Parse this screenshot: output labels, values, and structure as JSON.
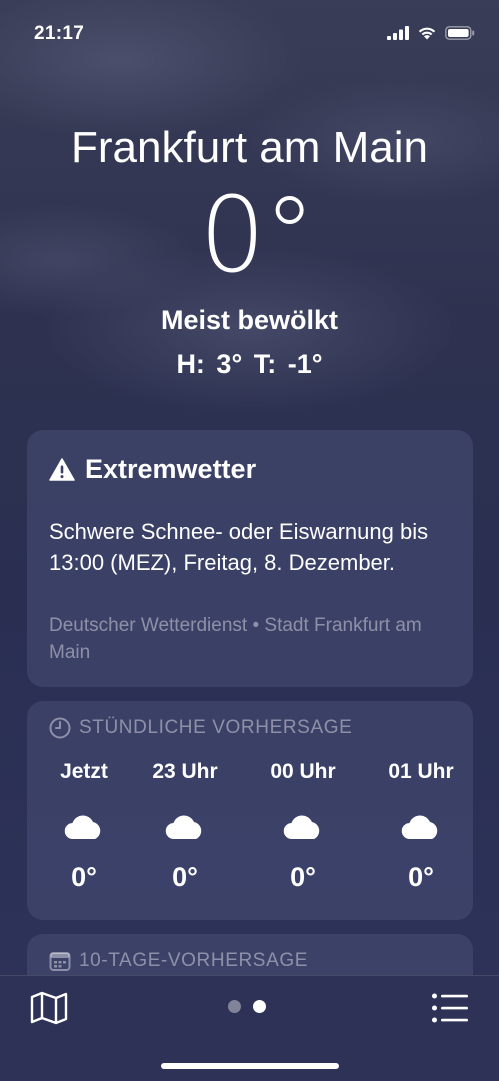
{
  "status": {
    "time": "21:17"
  },
  "location": {
    "city": "Frankfurt am Main"
  },
  "current": {
    "temp": "0°",
    "condition": "Meist bewölkt",
    "hilo": "H: 3°  T: -1°"
  },
  "alert": {
    "title": "Extremwetter",
    "body": "Schwere Schnee- oder Eiswarnung bis 13:00 (MEZ), Freitag, 8. Dezember.",
    "source": "Deutscher Wetterdienst • Stadt Frankfurt am Main"
  },
  "hourly": {
    "header": "STÜNDLICHE VORHERSAGE",
    "items": [
      {
        "label": "Jetzt",
        "icon": "cloud-icon",
        "temp": "0°"
      },
      {
        "label": "23 Uhr",
        "icon": "cloud-icon",
        "temp": "0°"
      },
      {
        "label": "00 Uhr",
        "icon": "cloud-icon",
        "temp": "0°"
      },
      {
        "label": "01 Uhr",
        "icon": "cloud-icon",
        "temp": "0°"
      }
    ]
  },
  "daily": {
    "header": "10-TAGE-VORHERSAGE"
  },
  "bottom": {
    "page_count": 2,
    "active_page": 2
  },
  "colors": {
    "background": "#2e3250",
    "card": "#484e76",
    "muted_text": "#9a9cb3"
  }
}
